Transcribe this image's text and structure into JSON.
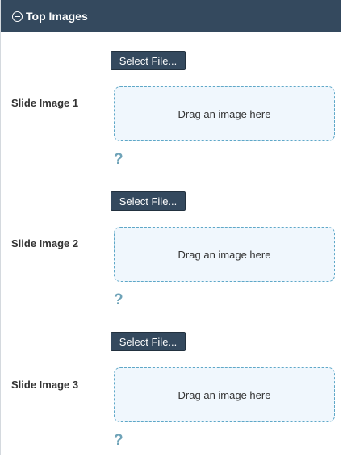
{
  "panel": {
    "title": "Top Images",
    "header_icon": "minus-circle-icon"
  },
  "slides": [
    {
      "label": "Slide Image 1",
      "button": "Select File...",
      "drop_text": "Drag an image here",
      "help_glyph": "?"
    },
    {
      "label": "Slide Image 2",
      "button": "Select File...",
      "drop_text": "Drag an image here",
      "help_glyph": "?"
    },
    {
      "label": "Slide Image 3",
      "button": "Select File...",
      "drop_text": "Drag an image here",
      "help_glyph": "?"
    }
  ],
  "colors": {
    "header_bg": "#34495e",
    "button_bg": "#34495e",
    "drop_border": "#5fa8c8",
    "drop_bg": "#f0f7fd",
    "help": "#6fa3b8"
  }
}
